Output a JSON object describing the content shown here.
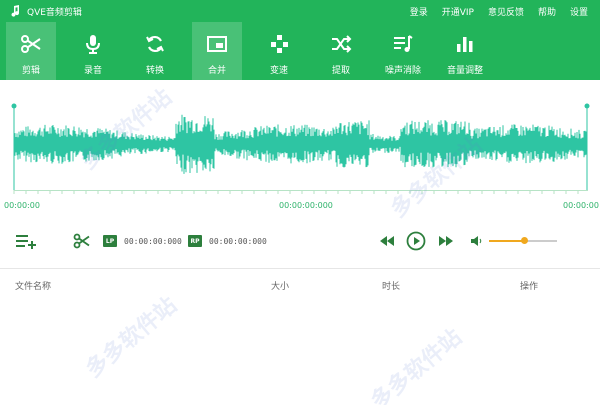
{
  "app": {
    "title": "QVE音频剪辑"
  },
  "top_links": [
    "登录",
    "开通VIP",
    "意见反馈",
    "帮助",
    "设置"
  ],
  "toolbar": {
    "items": [
      {
        "label": "剪辑",
        "icon": "scissors-icon",
        "active": true
      },
      {
        "label": "录音",
        "icon": "microphone-icon",
        "active": false
      },
      {
        "label": "转换",
        "icon": "convert-icon",
        "active": false
      },
      {
        "label": "合并",
        "icon": "merge-icon",
        "active": true
      },
      {
        "label": "变速",
        "icon": "speed-icon",
        "active": false
      },
      {
        "label": "提取",
        "icon": "extract-icon",
        "active": false
      },
      {
        "label": "噪声消除",
        "icon": "noise-reduction-icon",
        "active": false
      },
      {
        "label": "音量调整",
        "icon": "volume-adjust-icon",
        "active": false
      }
    ]
  },
  "waveform": {
    "time_start": "00:00:00",
    "time_mid": "00:00:00:000",
    "time_end": "00:00:00"
  },
  "controls": {
    "lp_label": "LP",
    "lp_time": "00:00:00:000",
    "rp_label": "RP",
    "rp_time": "00:00:00:000",
    "volume_level": 0.52
  },
  "file_list": {
    "columns": [
      "文件名称",
      "大小",
      "时长",
      "操作"
    ]
  },
  "colors": {
    "brand": "#22b45a",
    "wave": "#2ec5a3",
    "accent": "#f0a81e"
  },
  "watermark": "多多软件站"
}
